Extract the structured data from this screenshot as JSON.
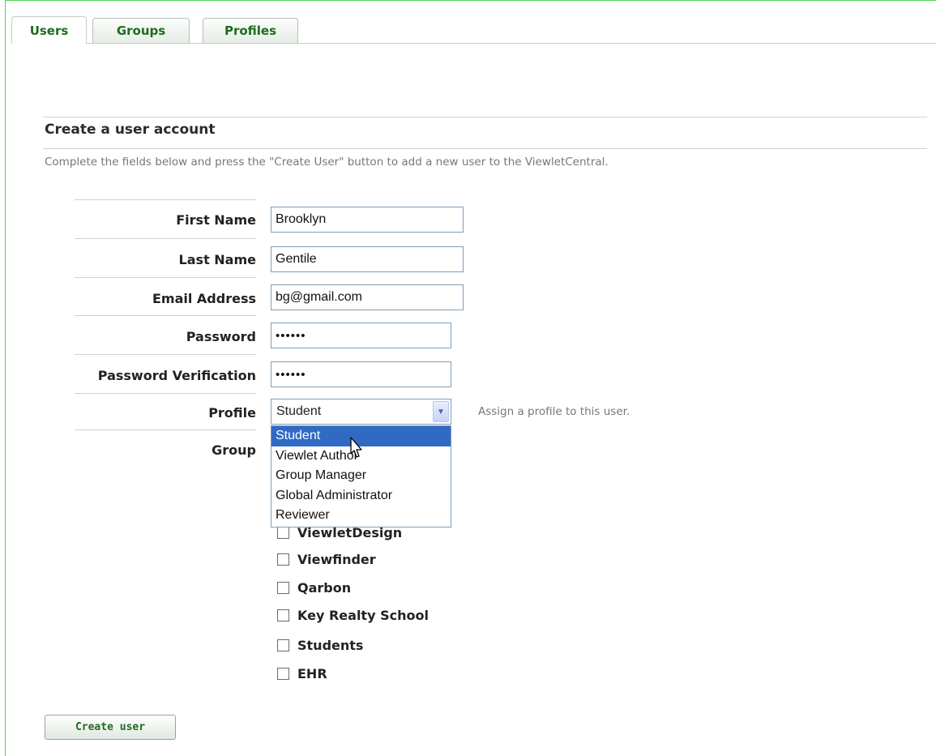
{
  "tabs": [
    {
      "label": "Users",
      "active": true
    },
    {
      "label": "Groups",
      "active": false
    },
    {
      "label": "Profiles",
      "active": false
    }
  ],
  "section": {
    "title": "Create a user account",
    "description": "Complete the fields below and press the \"Create User\" button to add a new user to the ViewletCentral."
  },
  "form": {
    "first_name": {
      "label": "First Name",
      "value": "Brooklyn"
    },
    "last_name": {
      "label": "Last Name",
      "value": "Gentile"
    },
    "email": {
      "label": "Email Address",
      "value": "bg@gmail.com"
    },
    "password": {
      "label": "Password",
      "value": "••••••"
    },
    "password_verification": {
      "label": "Password Verification",
      "value": "••••••"
    },
    "profile": {
      "label": "Profile",
      "selected": "Student",
      "hint": "Assign a profile to this user.",
      "options": [
        "Student",
        "Viewlet Author",
        "Group Manager",
        "Global Administrator",
        "Reviewer"
      ]
    },
    "group": {
      "label": "Group",
      "items": [
        "ViewletDesign",
        "Viewfinder",
        "Qarbon",
        "Key Realty School",
        "Students",
        "EHR"
      ]
    }
  },
  "create_button": "Create user",
  "colors": {
    "accent_green": "#1f6b1f",
    "frame_green": "#4fd44f",
    "selection_blue": "#316ac5"
  }
}
